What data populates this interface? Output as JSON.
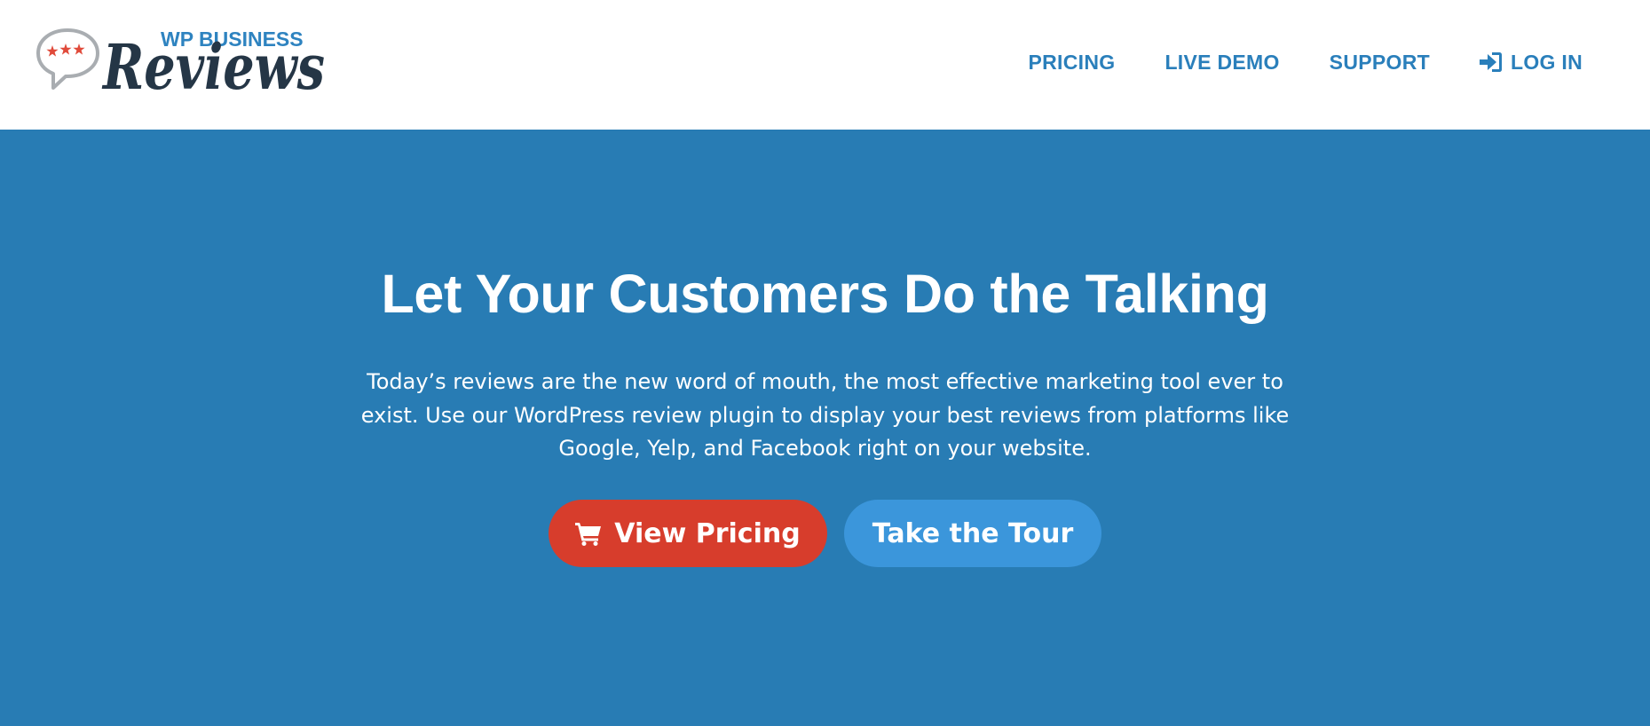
{
  "header": {
    "logo": {
      "top_text": "WP BUSINESS",
      "main_text": "Reviews"
    },
    "nav": [
      {
        "label": "PRICING",
        "icon": null
      },
      {
        "label": "LIVE DEMO",
        "icon": null
      },
      {
        "label": "SUPPORT",
        "icon": null
      },
      {
        "label": "LOG IN",
        "icon": "sign-in-icon"
      }
    ]
  },
  "hero": {
    "title": "Let Your Customers Do the Talking",
    "description": "Today’s reviews are the new word of mouth, the most effective marketing tool ever to exist. Use our WordPress review plugin to display your best reviews from platforms like Google, Yelp, and Facebook right on your website.",
    "primary_button": {
      "label": "View Pricing",
      "icon": "shopping-cart-icon"
    },
    "secondary_button": {
      "label": "Take the Tour"
    }
  },
  "colors": {
    "brand_blue": "#2a7fbb",
    "hero_background": "#287cb4",
    "primary_button": "#d73d2c",
    "secondary_button": "#3b96db",
    "logo_dark": "#253646",
    "logo_star_red": "#e04a3a"
  }
}
